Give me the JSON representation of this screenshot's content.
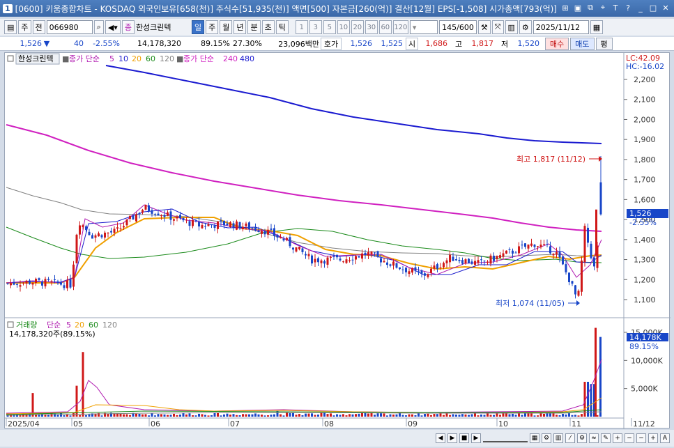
{
  "window": {
    "app_num": "1",
    "title": "[0600] 키움종합차트 - KOSDAQ 외국인보유[658(천)] 주식수[51,935(천)] 액면[500] 자본금[260(억)] 결산[12월] EPS[-1,508] 시가총액[793(억)]"
  },
  "toolbar": {
    "code": "066980",
    "stock_name": "한성크린텍",
    "period_buttons": [
      "일",
      "주",
      "월",
      "년",
      "분",
      "초",
      "틱"
    ],
    "number_buttons": [
      "1",
      "3",
      "5",
      "10",
      "20",
      "30",
      "60",
      "120"
    ],
    "count": "145",
    "count_total": "/600",
    "date": "2025/11/12",
    "left_buttons": [
      "주",
      "전"
    ]
  },
  "quote": {
    "price": "1,526",
    "change": "40",
    "change_pct": "-2.55%",
    "volume": "14,178,320",
    "vol_ratio": "89.15%",
    "turnover": "27.30%",
    "amount": "23,096백만",
    "bid_label": "호가",
    "bid1": "1,526",
    "bid2": "1,525",
    "open_label": "시",
    "open": "1,686",
    "high_label": "고",
    "high": "1,817",
    "low_label": "저",
    "low": "1,520",
    "buy": "매수",
    "sell": "매도",
    "eval": "평"
  },
  "price_legend": {
    "name": "한성크린텍",
    "ma_label": "종가 단순",
    "periods": [
      "5",
      "10",
      "20",
      "60",
      "120"
    ],
    "long_label": "종가 단순",
    "long_periods": [
      "240",
      "480"
    ]
  },
  "price_axis": {
    "lc": "LC:42.09",
    "hc": "HC:-16.02",
    "ticks": [
      "2,200",
      "2,100",
      "2,000",
      "1,900",
      "1,800",
      "1,700",
      "1,600",
      "1,500",
      "1,400",
      "1,300",
      "1,200",
      "1,100"
    ],
    "current_price": "1,526",
    "current_pct": "-2.55%"
  },
  "annotations": {
    "high": "최고 1,817 (11/12)",
    "low": "최저 1,074 (11/05)"
  },
  "volume_legend": {
    "label": "거래량",
    "ma_label": "단순",
    "periods": [
      "5",
      "20",
      "60",
      "120"
    ],
    "value": "14,178,320주(89.15%)"
  },
  "volume_axis": {
    "ticks": [
      "15,000K",
      "10,000K",
      "5,000K"
    ],
    "current": "14,178K",
    "current_pct": "89.15%"
  },
  "x_axis": {
    "labels": [
      "2025/04",
      "05",
      "06",
      "07",
      "08",
      "09",
      "10",
      "11",
      "11/12"
    ]
  },
  "colors": {
    "up": "#d01818",
    "down": "#1846c8",
    "ma5": "#b01ab0",
    "ma10": "#1a1acc",
    "ma20": "#f0a000",
    "ma60": "#1a8a1a",
    "ma120": "#808080",
    "ma240": "#d020c0",
    "ma480": "#1a1ad0"
  }
}
